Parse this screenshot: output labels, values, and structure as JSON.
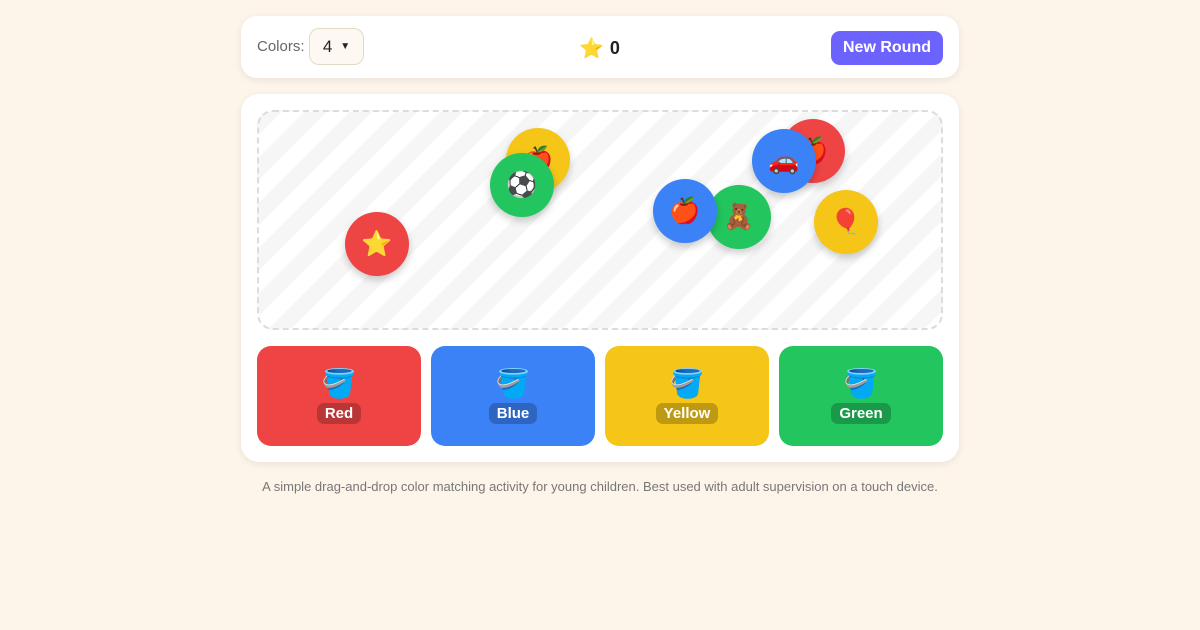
{
  "header": {
    "colors_label": "Colors:",
    "colors_value": "4",
    "score": "0",
    "new_round_label": "New Round"
  },
  "tokens": [
    {
      "color": "#f5c518",
      "emoji": "🍎",
      "color_name": "yellow"
    },
    {
      "color": "#22c55e",
      "emoji": "⚽",
      "color_name": "green"
    },
    {
      "color": "#ef4444",
      "emoji": "⭐",
      "color_name": "red"
    },
    {
      "color": "#ef4444",
      "emoji": "🍎",
      "color_name": "red"
    },
    {
      "color": "#3b82f6",
      "emoji": "🚗",
      "color_name": "blue"
    },
    {
      "color": "#22c55e",
      "emoji": "🧸",
      "color_name": "green"
    },
    {
      "color": "#3b82f6",
      "emoji": "🍎",
      "color_name": "blue"
    },
    {
      "color": "#f5c518",
      "emoji": "🎈",
      "color_name": "yellow"
    }
  ],
  "bins": [
    {
      "label": "Red",
      "color": "#ef4444"
    },
    {
      "label": "Blue",
      "color": "#3b82f6"
    },
    {
      "label": "Yellow",
      "color": "#f5c518"
    },
    {
      "label": "Green",
      "color": "#22c55e"
    }
  ],
  "bin_icon": "🪣",
  "footer_text": "A simple drag-and-drop color matching activity for young children. Best used with adult supervision on a touch device."
}
